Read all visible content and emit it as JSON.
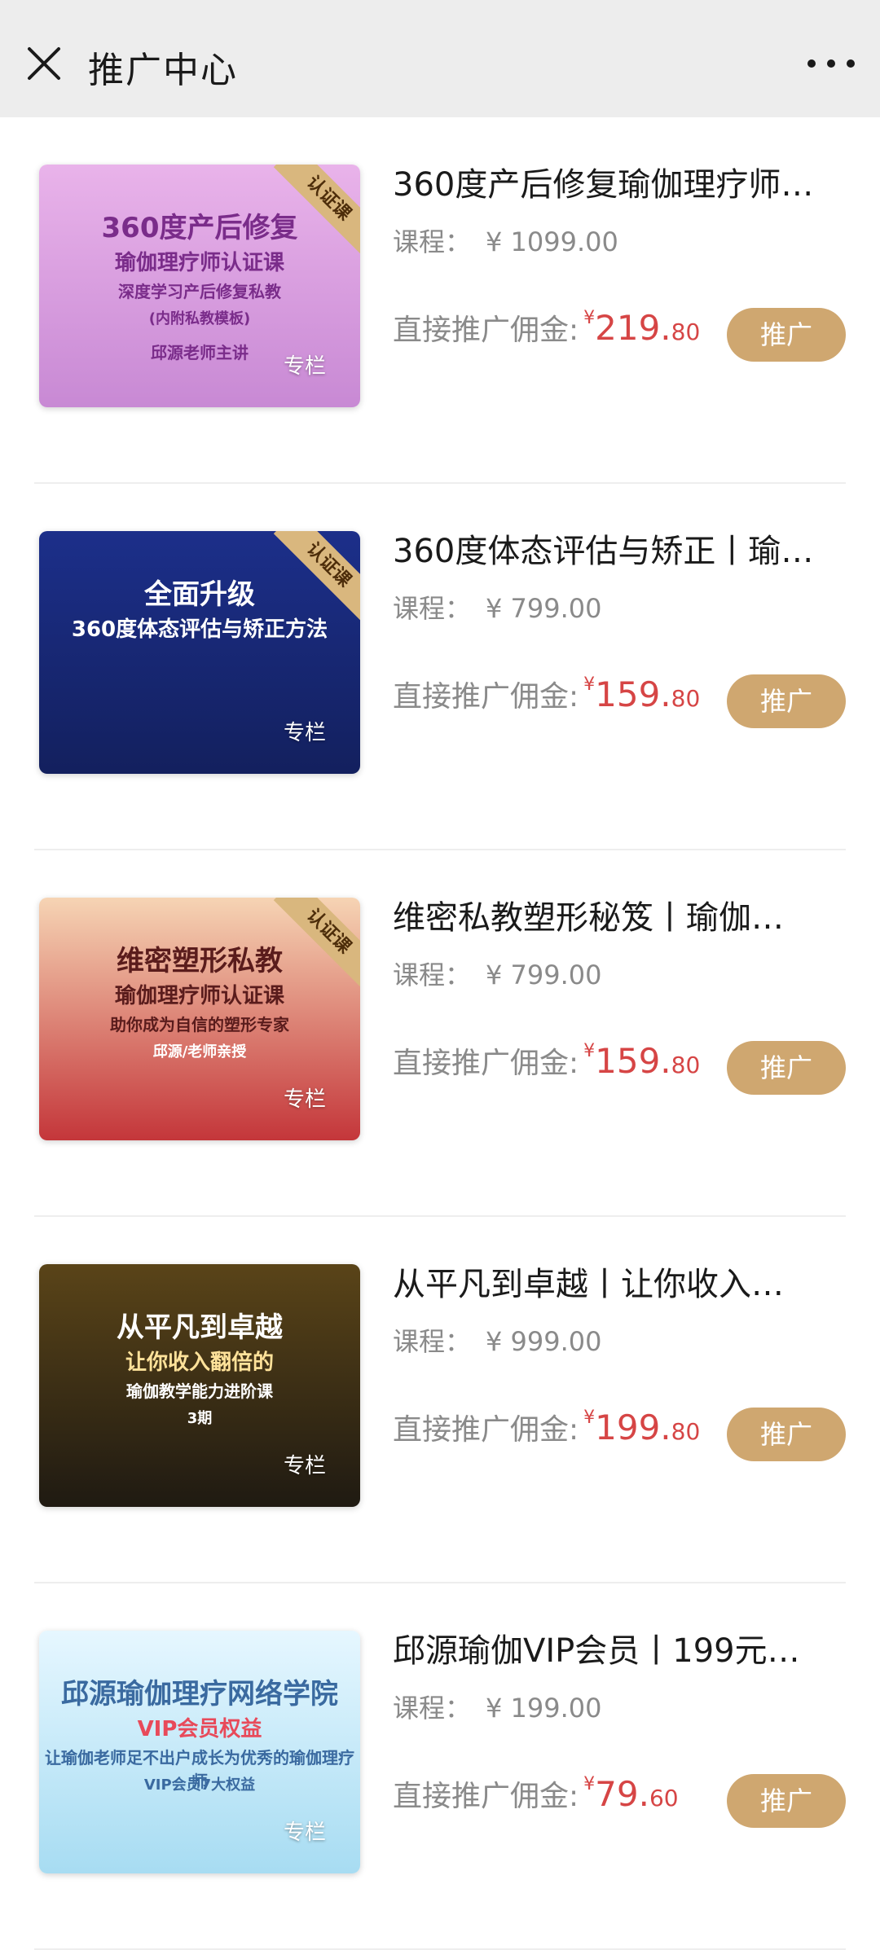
{
  "header": {
    "title": "推广中心",
    "close_icon": "close-icon",
    "more_icon": "more-icon"
  },
  "labels": {
    "price_label": "课程：",
    "commission_label": "直接推广佣金:",
    "currency": "¥",
    "badge": "认证课",
    "column_tag": "专栏",
    "promote_button": "推广"
  },
  "courses": [
    {
      "title": "360度产后修复瑜伽理疗师…",
      "price": "¥ 1099.00",
      "commission_int": "219.",
      "commission_dec": "80",
      "thumb_lines": [
        "360度产后修复",
        "瑜伽理疗师认证课",
        "深度学习产后修复私教",
        "(内附私教模板)",
        "邱源老师主讲"
      ],
      "thumb_colors": [
        "#e9b3ea",
        "#c889d4"
      ],
      "has_badge": true
    },
    {
      "title": "360度体态评估与矫正丨瑜…",
      "price": "¥ 799.00",
      "commission_int": "159.",
      "commission_dec": "80",
      "thumb_lines": [
        "全面升级",
        "360度体态评估与矫正方法"
      ],
      "thumb_colors": [
        "#1c2f8a",
        "#13205e"
      ],
      "has_badge": true
    },
    {
      "title": "维密私教塑形秘笈丨瑜伽…",
      "price": "¥ 799.00",
      "commission_int": "159.",
      "commission_dec": "80",
      "thumb_lines": [
        "维密塑形私教",
        "瑜伽理疗师认证课",
        "助你成为自信的塑形专家",
        "邱源/老师亲授"
      ],
      "thumb_colors": [
        "#f6d4b4",
        "#c4363a"
      ],
      "has_badge": true
    },
    {
      "title": "从平凡到卓越丨让你收入…",
      "price": "¥ 999.00",
      "commission_int": "199.",
      "commission_dec": "80",
      "thumb_lines": [
        "从平凡到卓越",
        "让你收入翻倍的",
        "瑜伽教学能力进阶课",
        "3期"
      ],
      "thumb_colors": [
        "#5a4418",
        "#1f1a12"
      ],
      "has_badge": false
    },
    {
      "title": "邱源瑜伽VIP会员丨199元…",
      "price": "¥ 199.00",
      "commission_int": "79.",
      "commission_dec": "60",
      "thumb_lines": [
        "邱源瑜伽理疗网络学院",
        "VIP会员权益",
        "让瑜伽老师足不出户成长为优秀的瑜伽理疗师",
        "VIP会员7大权益"
      ],
      "thumb_colors": [
        "#e6f7ff",
        "#a7dcf2"
      ],
      "has_badge": false
    }
  ]
}
